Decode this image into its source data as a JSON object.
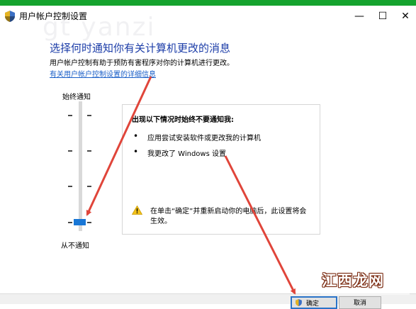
{
  "window": {
    "title": "用户帐户控制设置",
    "watermark": "gt yanzi",
    "minimize_glyph": "—",
    "maximize_glyph": "☐",
    "close_glyph": "✕",
    "accent_color": "#15a32e"
  },
  "main": {
    "heading": "选择何时通知你有关计算机更改的消息",
    "description": "用户帐户控制有助于预防有害程序对你的计算机进行更改。",
    "help_link": "有关用户帐户控制设置的详细信息"
  },
  "slider": {
    "top_label": "始终通知",
    "bottom_label": "从不通知",
    "level_index": 3,
    "level_count": 4,
    "thumb_color": "#1977d6"
  },
  "info_panel": {
    "title": "出现以下情况时始终不要通知我:",
    "bullets": [
      "应用尝试安装软件或更改我的计算机",
      "我更改了 Windows 设置"
    ],
    "warning_text": "在单击“确定”并重新启动你的电脑后，此设置将会生效。",
    "bullet_glyph": "•"
  },
  "buttons": {
    "ok_label": "确定",
    "cancel_label": "取消"
  },
  "annotations": {
    "arrow_color": "#e0453a"
  },
  "site_logo": {
    "text": "江西龙网"
  }
}
